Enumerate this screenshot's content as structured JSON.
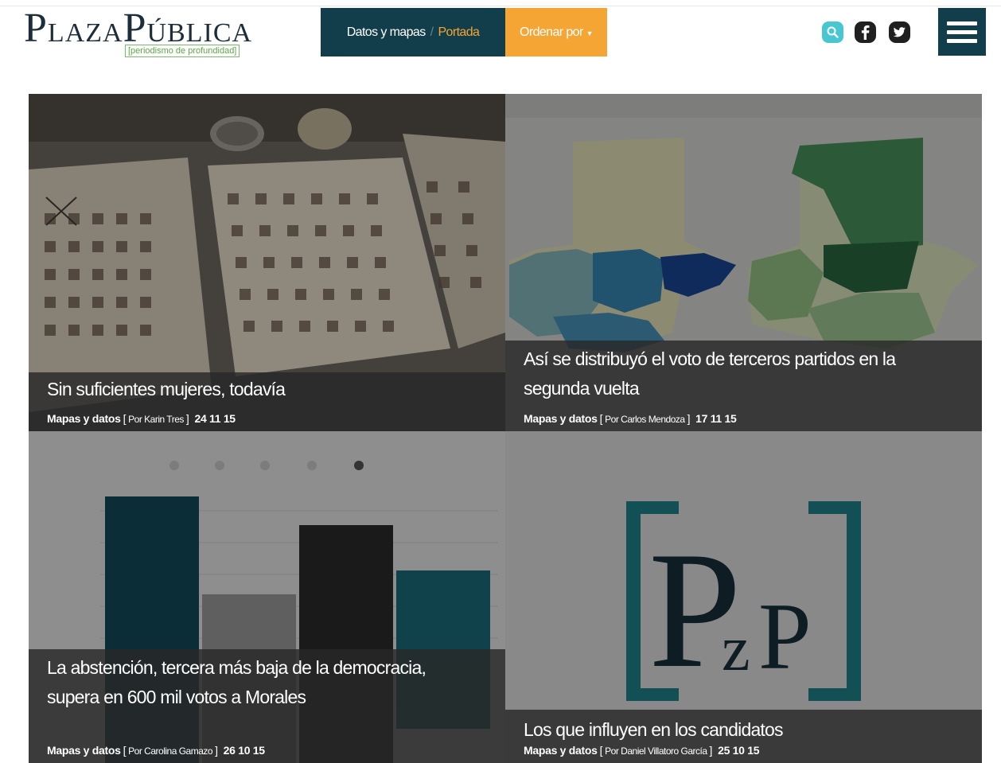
{
  "header": {
    "logo_word1_initial": "P",
    "logo_word1_rest": "LAZA",
    "logo_word2_initial": "P",
    "logo_word2_rest": "ÚBLICA",
    "logo_tagline": "[periodismo de profundidad]",
    "breadcrumb_section": "Datos y mapas",
    "breadcrumb_separator": "/",
    "breadcrumb_current": "Portada",
    "sort_label": "Ordenar por",
    "search_icon": "search-icon",
    "facebook_icon": "facebook-icon",
    "twitter_icon": "twitter-icon",
    "menu_icon": "hamburger-menu-icon"
  },
  "colors": {
    "navy": "#123e4b",
    "orange": "#f5a533",
    "teal": "#48c7d3",
    "caption_overlay": "#282828"
  },
  "articles": [
    {
      "title": "Sin suficientes mujeres, todavía",
      "category": "Mapas y datos",
      "open_bracket": "[",
      "author": "Por Karin Tres",
      "close_bracket": "]",
      "date": "24 11 15"
    },
    {
      "title": "Así se distribuyó el voto de terceros partidos en la segunda vuelta",
      "category": "Mapas y datos",
      "open_bracket": "[",
      "author": "Por Carlos Mendoza",
      "close_bracket": "]",
      "date": "17 11 15"
    },
    {
      "title": "La abstención, tercera más baja de la democracia, supera en 600 mil votos a Morales",
      "category": "Mapas y datos",
      "open_bracket": "[",
      "author": "Por Carolina Gamazo",
      "close_bracket": "]",
      "date": "26 10 15"
    },
    {
      "title": "Los que influyen en los candidatos",
      "category": "Mapas y datos",
      "open_bracket": "[",
      "author": "Por Daniel Villatoro García",
      "close_bracket": "]",
      "date": "25 10 15",
      "image_letters": "PzP"
    }
  ]
}
